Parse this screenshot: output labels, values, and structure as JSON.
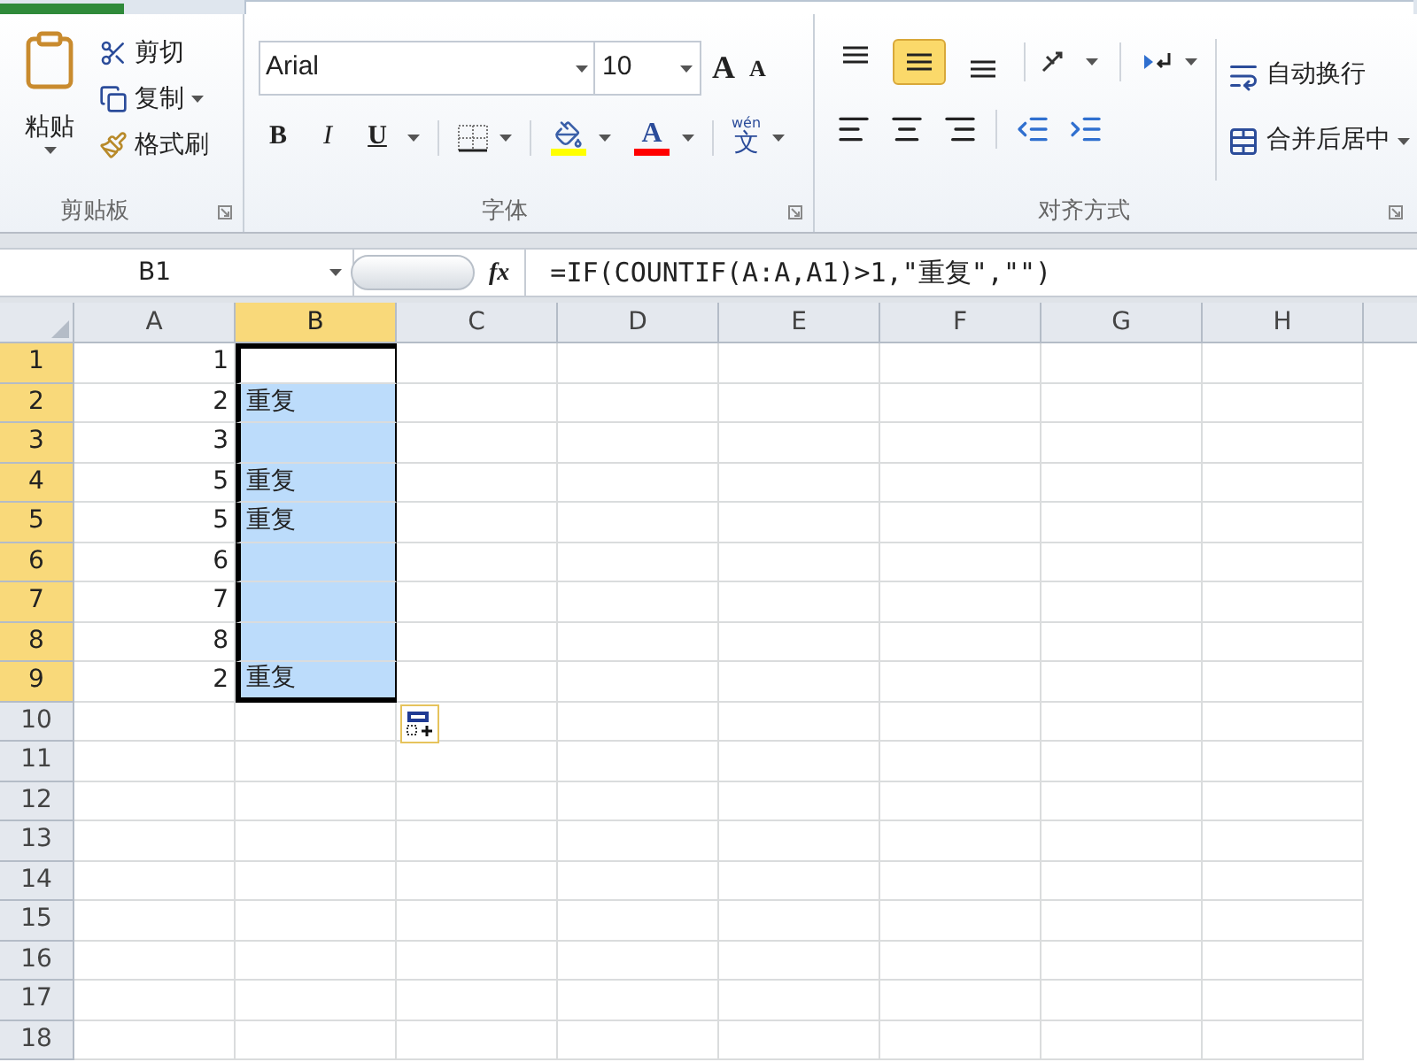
{
  "ribbon": {
    "clipboard": {
      "label": "剪贴板",
      "paste": "粘贴",
      "items": [
        {
          "kind": "cut",
          "label": "剪切",
          "dropdown": false
        },
        {
          "kind": "copy",
          "label": "复制",
          "dropdown": true
        },
        {
          "kind": "painter",
          "label": "格式刷",
          "dropdown": false
        }
      ]
    },
    "font": {
      "label": "字体",
      "name": "Arial",
      "size": "10",
      "grow": "A",
      "shrink": "A",
      "styles": [
        {
          "kind": "bold",
          "label": "B"
        },
        {
          "kind": "italic",
          "label": "I"
        },
        {
          "kind": "underline",
          "label": "U"
        }
      ],
      "fill_button": {
        "color": "#ffff00"
      },
      "font_color_button": {
        "label": "A",
        "color": "#ff0000"
      },
      "phonetic_top": "wén",
      "phonetic_main": "文"
    },
    "alignment": {
      "label": "对齐方式",
      "vertical": [
        {
          "kind": "top",
          "selected": false
        },
        {
          "kind": "middle",
          "selected": true
        },
        {
          "kind": "bottom",
          "selected": false
        }
      ],
      "wrap": "自动换行",
      "merge": "合并后居中"
    }
  },
  "formula_bar": {
    "name_box": "B1",
    "fx": "fx",
    "formula": "=IF(COUNTIF(A:A,A1)>1,\"重复\",\"\")"
  },
  "columns": [
    {
      "label": "A",
      "selected": false
    },
    {
      "label": "B",
      "selected": true
    },
    {
      "label": "C",
      "selected": false
    },
    {
      "label": "D",
      "selected": false
    },
    {
      "label": "E",
      "selected": false
    },
    {
      "label": "F",
      "selected": false
    },
    {
      "label": "G",
      "selected": false
    },
    {
      "label": "H",
      "selected": false
    }
  ],
  "rows": [
    {
      "label": "1",
      "selected": true,
      "a": "1",
      "b_highlighted": false
    },
    {
      "label": "2",
      "selected": true,
      "a": "2",
      "b": "重复",
      "b_highlighted": true
    },
    {
      "label": "3",
      "selected": true,
      "a": "3",
      "b_highlighted": true
    },
    {
      "label": "4",
      "selected": true,
      "a": "5",
      "b": "重复",
      "b_highlighted": true
    },
    {
      "label": "5",
      "selected": true,
      "a": "5",
      "b": "重复",
      "b_highlighted": true
    },
    {
      "label": "6",
      "selected": true,
      "a": "6",
      "b_highlighted": true
    },
    {
      "label": "7",
      "selected": true,
      "a": "7",
      "b_highlighted": true
    },
    {
      "label": "8",
      "selected": true,
      "a": "8",
      "b_highlighted": true
    },
    {
      "label": "9",
      "selected": true,
      "a": "2",
      "b": "重复",
      "b_highlighted": true
    },
    {
      "label": "10",
      "selected": false,
      "paste_options": true
    },
    {
      "label": "11",
      "selected": false
    },
    {
      "label": "12",
      "selected": false
    },
    {
      "label": "13",
      "selected": false
    },
    {
      "label": "14",
      "selected": false
    },
    {
      "label": "15",
      "selected": false
    },
    {
      "label": "16",
      "selected": false
    },
    {
      "label": "17",
      "selected": false
    },
    {
      "label": "18",
      "selected": false
    }
  ]
}
